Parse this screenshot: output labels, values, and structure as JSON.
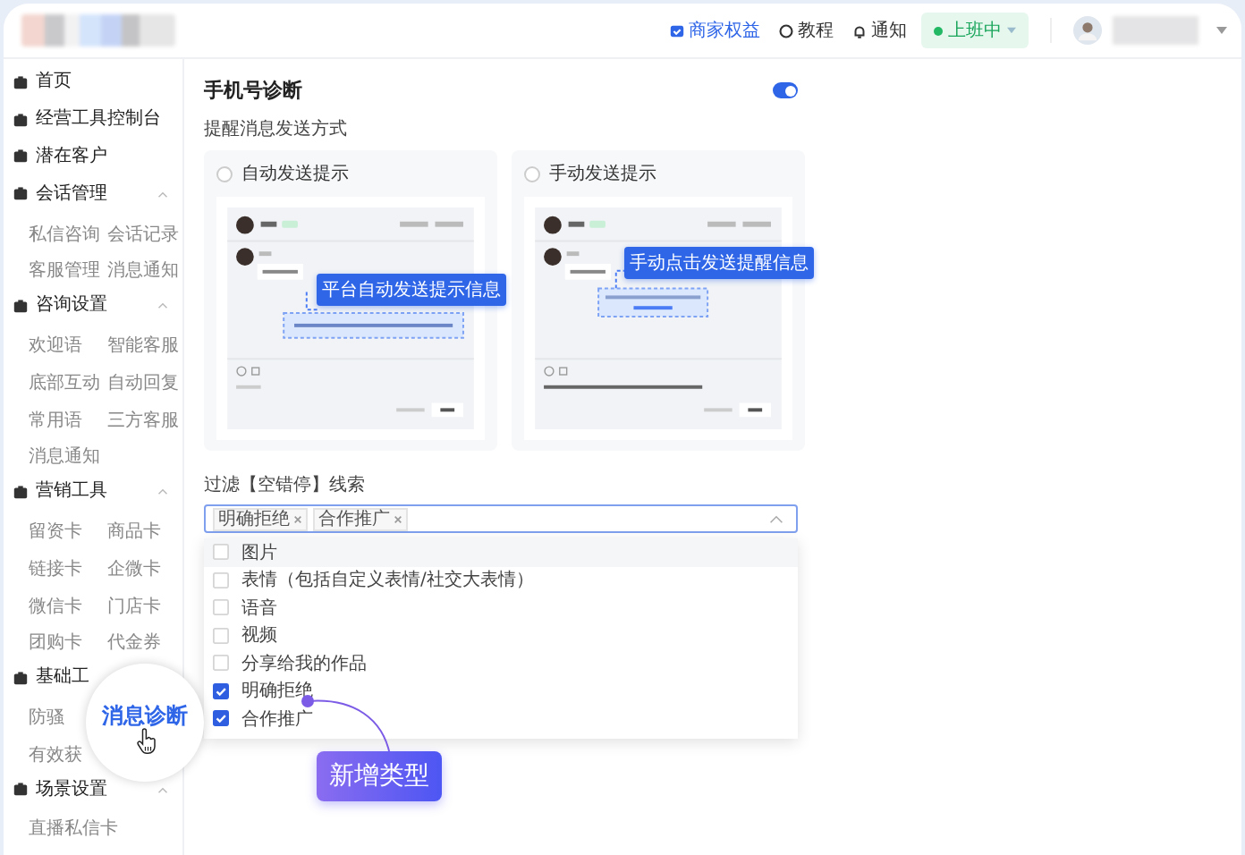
{
  "top_bar": {
    "links": [
      {
        "label": "商家权益",
        "active": true
      },
      {
        "label": "教程",
        "active": false
      },
      {
        "label": "通知",
        "active": false
      }
    ],
    "status": {
      "label": "上班中"
    }
  },
  "sidebar": {
    "items": [
      {
        "label": "首页"
      },
      {
        "label": "经营工具控制台"
      },
      {
        "label": "潜在客户"
      },
      {
        "label": "会话管理",
        "expanded": true,
        "children": [
          "私信咨询",
          "会话记录",
          "客服管理",
          "消息通知"
        ]
      },
      {
        "label": "咨询设置",
        "expanded": true,
        "children": [
          "欢迎语",
          "智能客服",
          "底部互动",
          "自动回复",
          "常用语",
          "三方客服",
          "消息通知"
        ]
      },
      {
        "label": "营销工具",
        "expanded": true,
        "children": [
          "留资卡",
          "商品卡",
          "链接卡",
          "企微卡",
          "微信卡",
          "门店卡",
          "团购卡",
          "代金券"
        ]
      },
      {
        "label": "基础工",
        "children": [
          "防骚",
          "有效获"
        ]
      },
      {
        "label": "场景设置",
        "expanded": true,
        "children": [
          "直播私信卡"
        ]
      }
    ]
  },
  "settings": {
    "title": "手机号诊断",
    "enabled": true,
    "send_mode_label": "提醒消息发送方式",
    "modes": [
      {
        "label": "自动发送提示",
        "selected": false,
        "kind": "auto",
        "bubble": "平台自动发送提示信息"
      },
      {
        "label": "手动发送提示",
        "selected": false,
        "kind": "manual",
        "bubble": "手动点击发送提醒信息"
      }
    ],
    "filter_label": "过滤【空错停】线索",
    "tags": [
      "明确拒绝",
      "合作推广"
    ],
    "options": [
      {
        "label": "图片",
        "checked": false
      },
      {
        "label": "表情（包括自定义表情/社交大表情）",
        "checked": false
      },
      {
        "label": "语音",
        "checked": false
      },
      {
        "label": "视频",
        "checked": false
      },
      {
        "label": "分享给我的作品",
        "checked": false
      },
      {
        "label": "明确拒绝",
        "checked": true
      },
      {
        "label": "合作推广",
        "checked": true
      }
    ]
  },
  "magnifier": {
    "label": "消息诊断"
  },
  "callout": {
    "label": "新增类型"
  }
}
